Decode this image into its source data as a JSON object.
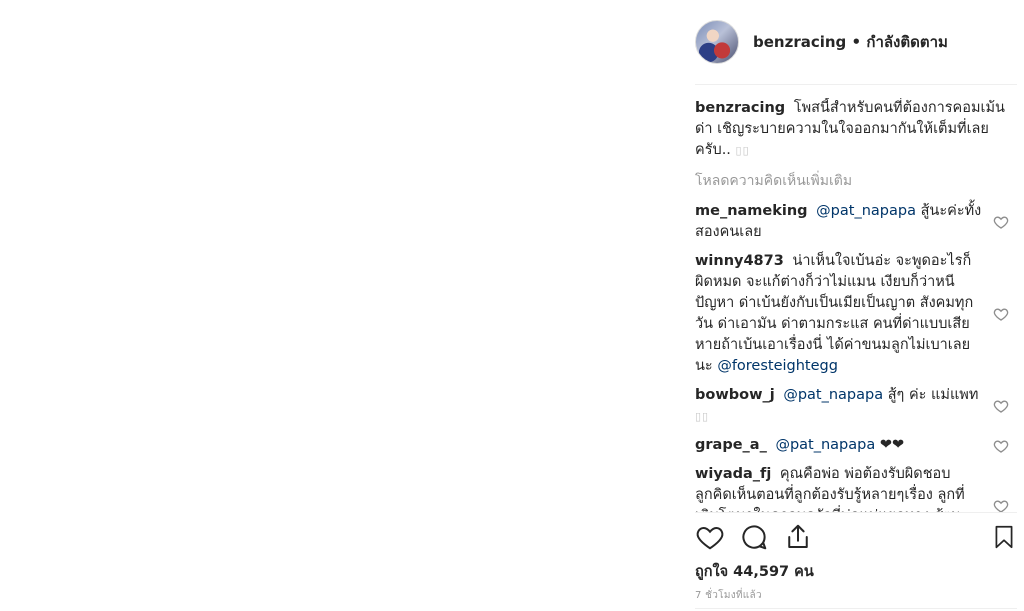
{
  "post": {
    "username": "benzracing",
    "follow_status": "กำลังติดตาม",
    "separator": "•"
  },
  "caption": {
    "username": "benzracing",
    "text": "โพสนี้สำหรับคนที่ต้องการคอมเม้นด่า เชิญระบายความในใจออกมากันให้เต็มที่เลยครับ.."
  },
  "load_more_label": "โหลดความคิดเห็นเพิ่มเติม",
  "comments": [
    {
      "username": "me_nameking",
      "mention": "@pat_napapa",
      "text": "สู้นะค่ะทั้งสองคนเลย"
    },
    {
      "username": "winny4873",
      "text": "น่าเห็นใจเบ้นอ่ะ จะพูดอะไรก็ผิดหมด จะแก้ต่างก็ว่าไม่แมน เงียบก็ว่าหนีปัญหา ด่าเบ้นยังกับเป็นเมียเป็นญาต สังคมทุกวัน ด่าเอามัน ด่าตามกระแส คนที่ด่าแบบเสียหายถ้าเบ้นเอาเรื่องนี่ ได้ค่าขนมลูกไม่เบาเลยนะ",
      "mention": "@foresteightegg"
    },
    {
      "username": "bowbow_j",
      "mention": "@pat_napapa",
      "text": "สู้ๆ ค่ะ แม่แพท"
    },
    {
      "username": "grape_a_",
      "mention": "@pat_napapa",
      "text": "❤❤"
    },
    {
      "username": "wiyada_fj",
      "text": "คุณคือพ่อ พ่อต้องรับผิดชอบลูกคิดเห็นตอนที่ลูกต้องรับรู้หลายๆเรื่อง ลูกที่เติบโตมาในครอบครัวที่พ่อแม่แยกทาง สู้ๆนะคะ"
    }
  ],
  "likes_text": "ถูกใจ 44,597 คน",
  "timestamp": "7 ชั่วโมงที่แล้ว",
  "icons": {
    "like": "heart-icon",
    "comment": "comment-icon",
    "share": "share-icon",
    "save": "bookmark-icon",
    "comment_like": "heart-icon"
  },
  "colors": {
    "text": "#262626",
    "muted": "#999999",
    "mention": "#003569",
    "border": "#efefef"
  }
}
